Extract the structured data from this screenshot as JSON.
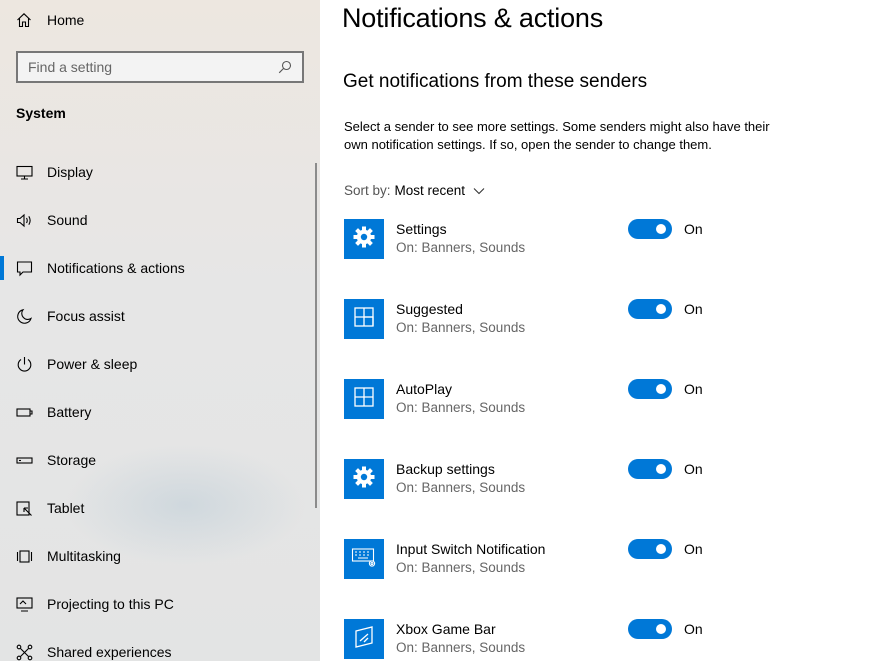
{
  "sidebar": {
    "home_label": "Home",
    "search_placeholder": "Find a setting",
    "section_title": "System",
    "items": [
      {
        "label": "Display",
        "icon": "display-icon"
      },
      {
        "label": "Sound",
        "icon": "speaker-icon"
      },
      {
        "label": "Notifications & actions",
        "icon": "notification-icon",
        "active": true
      },
      {
        "label": "Focus assist",
        "icon": "moon-icon"
      },
      {
        "label": "Power & sleep",
        "icon": "power-icon"
      },
      {
        "label": "Battery",
        "icon": "battery-icon"
      },
      {
        "label": "Storage",
        "icon": "storage-icon"
      },
      {
        "label": "Tablet",
        "icon": "tablet-icon"
      },
      {
        "label": "Multitasking",
        "icon": "multitasking-icon"
      },
      {
        "label": "Projecting to this PC",
        "icon": "projecting-icon"
      },
      {
        "label": "Shared experiences",
        "icon": "shared-experiences-icon"
      }
    ]
  },
  "main": {
    "title": "Notifications & actions",
    "subtitle": "Get notifications from these senders",
    "description": "Select a sender to see more settings. Some senders might also have their own notification settings. If so, open the sender to change them.",
    "sort_label": "Sort by:",
    "sort_value": "Most recent",
    "senders": [
      {
        "name": "Settings",
        "status": "On: Banners, Sounds",
        "toggle": "On",
        "icon": "gear-icon"
      },
      {
        "name": "Suggested",
        "status": "On: Banners, Sounds",
        "toggle": "On",
        "icon": "app-tile-icon"
      },
      {
        "name": "AutoPlay",
        "status": "On: Banners, Sounds",
        "toggle": "On",
        "icon": "app-tile-icon"
      },
      {
        "name": "Backup settings",
        "status": "On: Banners, Sounds",
        "toggle": "On",
        "icon": "gear-icon"
      },
      {
        "name": "Input Switch Notification",
        "status": "On: Banners, Sounds",
        "toggle": "On",
        "icon": "keyboard-icon"
      },
      {
        "name": "Xbox Game Bar",
        "status": "On: Banners, Sounds",
        "toggle": "On",
        "icon": "game-bar-icon"
      }
    ]
  },
  "colors": {
    "accent": "#0078d7",
    "sidebar_bg": "#e6e6e6",
    "secondary_text": "#666666"
  }
}
